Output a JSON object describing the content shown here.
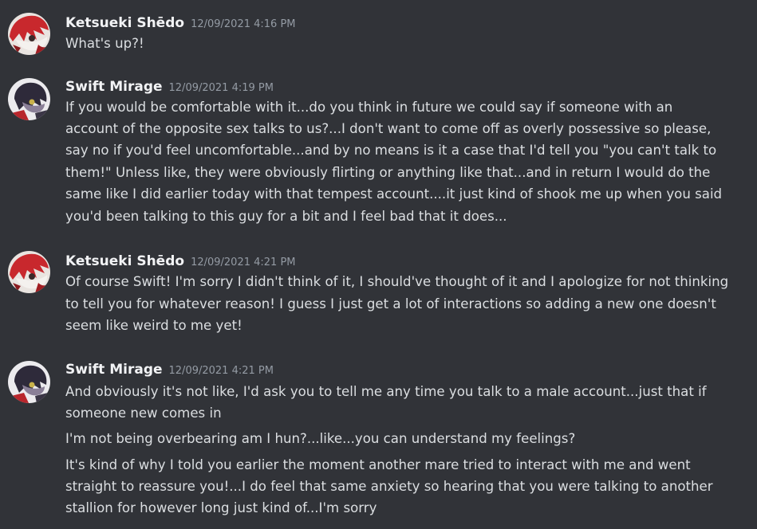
{
  "messages": [
    {
      "author": "Ketsueki Shēdo",
      "timestamp": "12/09/2021 4:16 PM",
      "avatar_icon": "red-pony-avatar-icon",
      "lines": [
        "What's up?!"
      ]
    },
    {
      "author": "Swift Mirage",
      "timestamp": "12/09/2021 4:19 PM",
      "avatar_icon": "dark-pony-avatar-icon",
      "lines": [
        "If you would be comfortable with it...do you think in future we could say if someone with an",
        "account of the opposite sex talks to us?...I don't want to come off as overly possessive so please,",
        "say no if you'd feel uncomfortable...and by no means is it a case that I'd tell you \"you can't talk to",
        "them!\" Unless like, they were obviously flirting or anything like that...and in return I would do the",
        "same like I did earlier today with that tempest account....it just kind of shook me up when you said",
        "you'd been talking to this guy for a bit and I feel bad that it does..."
      ]
    },
    {
      "author": "Ketsueki Shēdo",
      "timestamp": "12/09/2021 4:21 PM",
      "avatar_icon": "red-pony-avatar-icon",
      "lines": [
        "Of course Swift! I'm sorry I didn't think of it, I should've thought of it and I apologize for not thinking",
        "to tell you for whatever reason! I guess I just get a lot of interactions so adding a new one doesn't",
        "seem like weird to me yet!"
      ]
    },
    {
      "author": "Swift Mirage",
      "timestamp": "12/09/2021 4:21 PM",
      "avatar_icon": "dark-pony-avatar-icon",
      "lines": [
        "And obviously it's not like, I'd ask you to tell me any time you talk to a male account...just that if",
        "someone new comes in",
        "I'm not being overbearing am I hun?...like...you can understand my feelings?",
        "It's kind of why I told you earlier the moment another mare tried to interact with me and went",
        "straight to reassure you!...I do feel that same anxiety so hearing that you were talking to another",
        "stallion for however long just kind of...I'm sorry"
      ]
    }
  ],
  "colors": {
    "background": "#313338",
    "username": "#f2f3f5",
    "timestamp": "#949ba4",
    "text": "#dbdee1"
  }
}
